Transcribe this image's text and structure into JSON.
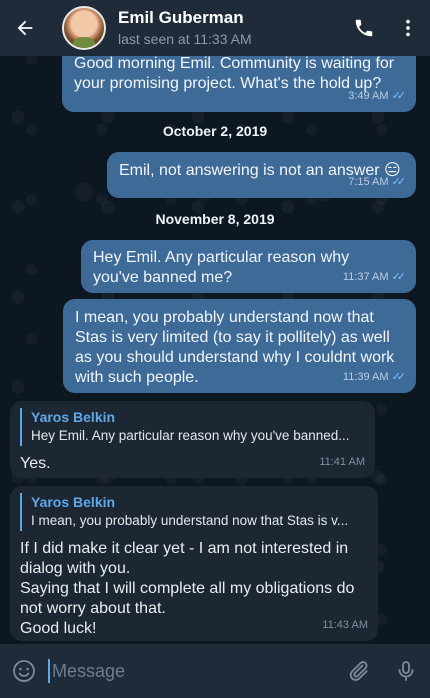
{
  "header": {
    "name": "Emil Guberman",
    "status": "last seen at 11:33 AM"
  },
  "messages": [
    {
      "text": "Good morning Emil. Community is waiting for your promising project. What's the hold up?",
      "time": "3:49 AM"
    },
    {
      "text": "Emil, not answering is not an answer 😑",
      "time": "7:15 AM"
    },
    {
      "text": "Hey Emil. Any particular reason why you've banned me?",
      "time": "11:37 AM"
    },
    {
      "text": "I mean, you probably understand now that Stas is very limited (to say it pollitely) as well as you should understand why I couldnt work with such people.",
      "time": "11:39 AM"
    },
    {
      "reply_name": "Yaros Belkin",
      "reply_text": "Hey Emil. Any particular reason why you've banned...",
      "text": "Yes.",
      "time": "11:41 AM"
    },
    {
      "reply_name": "Yaros Belkin",
      "reply_text": "I mean, you probably understand now that Stas is v...",
      "text": "If I did make it clear yet - I am not interested in dialog with you.\nSaying that I will complete all my obligations do not worry about that.\nGood luck!",
      "time": "11:43 AM"
    }
  ],
  "dates": [
    "October 2, 2019",
    "November 8, 2019"
  ],
  "composer": {
    "placeholder": "Message"
  },
  "colors": {
    "outgoing": "#3e6a98",
    "incoming": "#1c2733",
    "accent": "#5fa8e8",
    "header": "#1f2b38"
  }
}
